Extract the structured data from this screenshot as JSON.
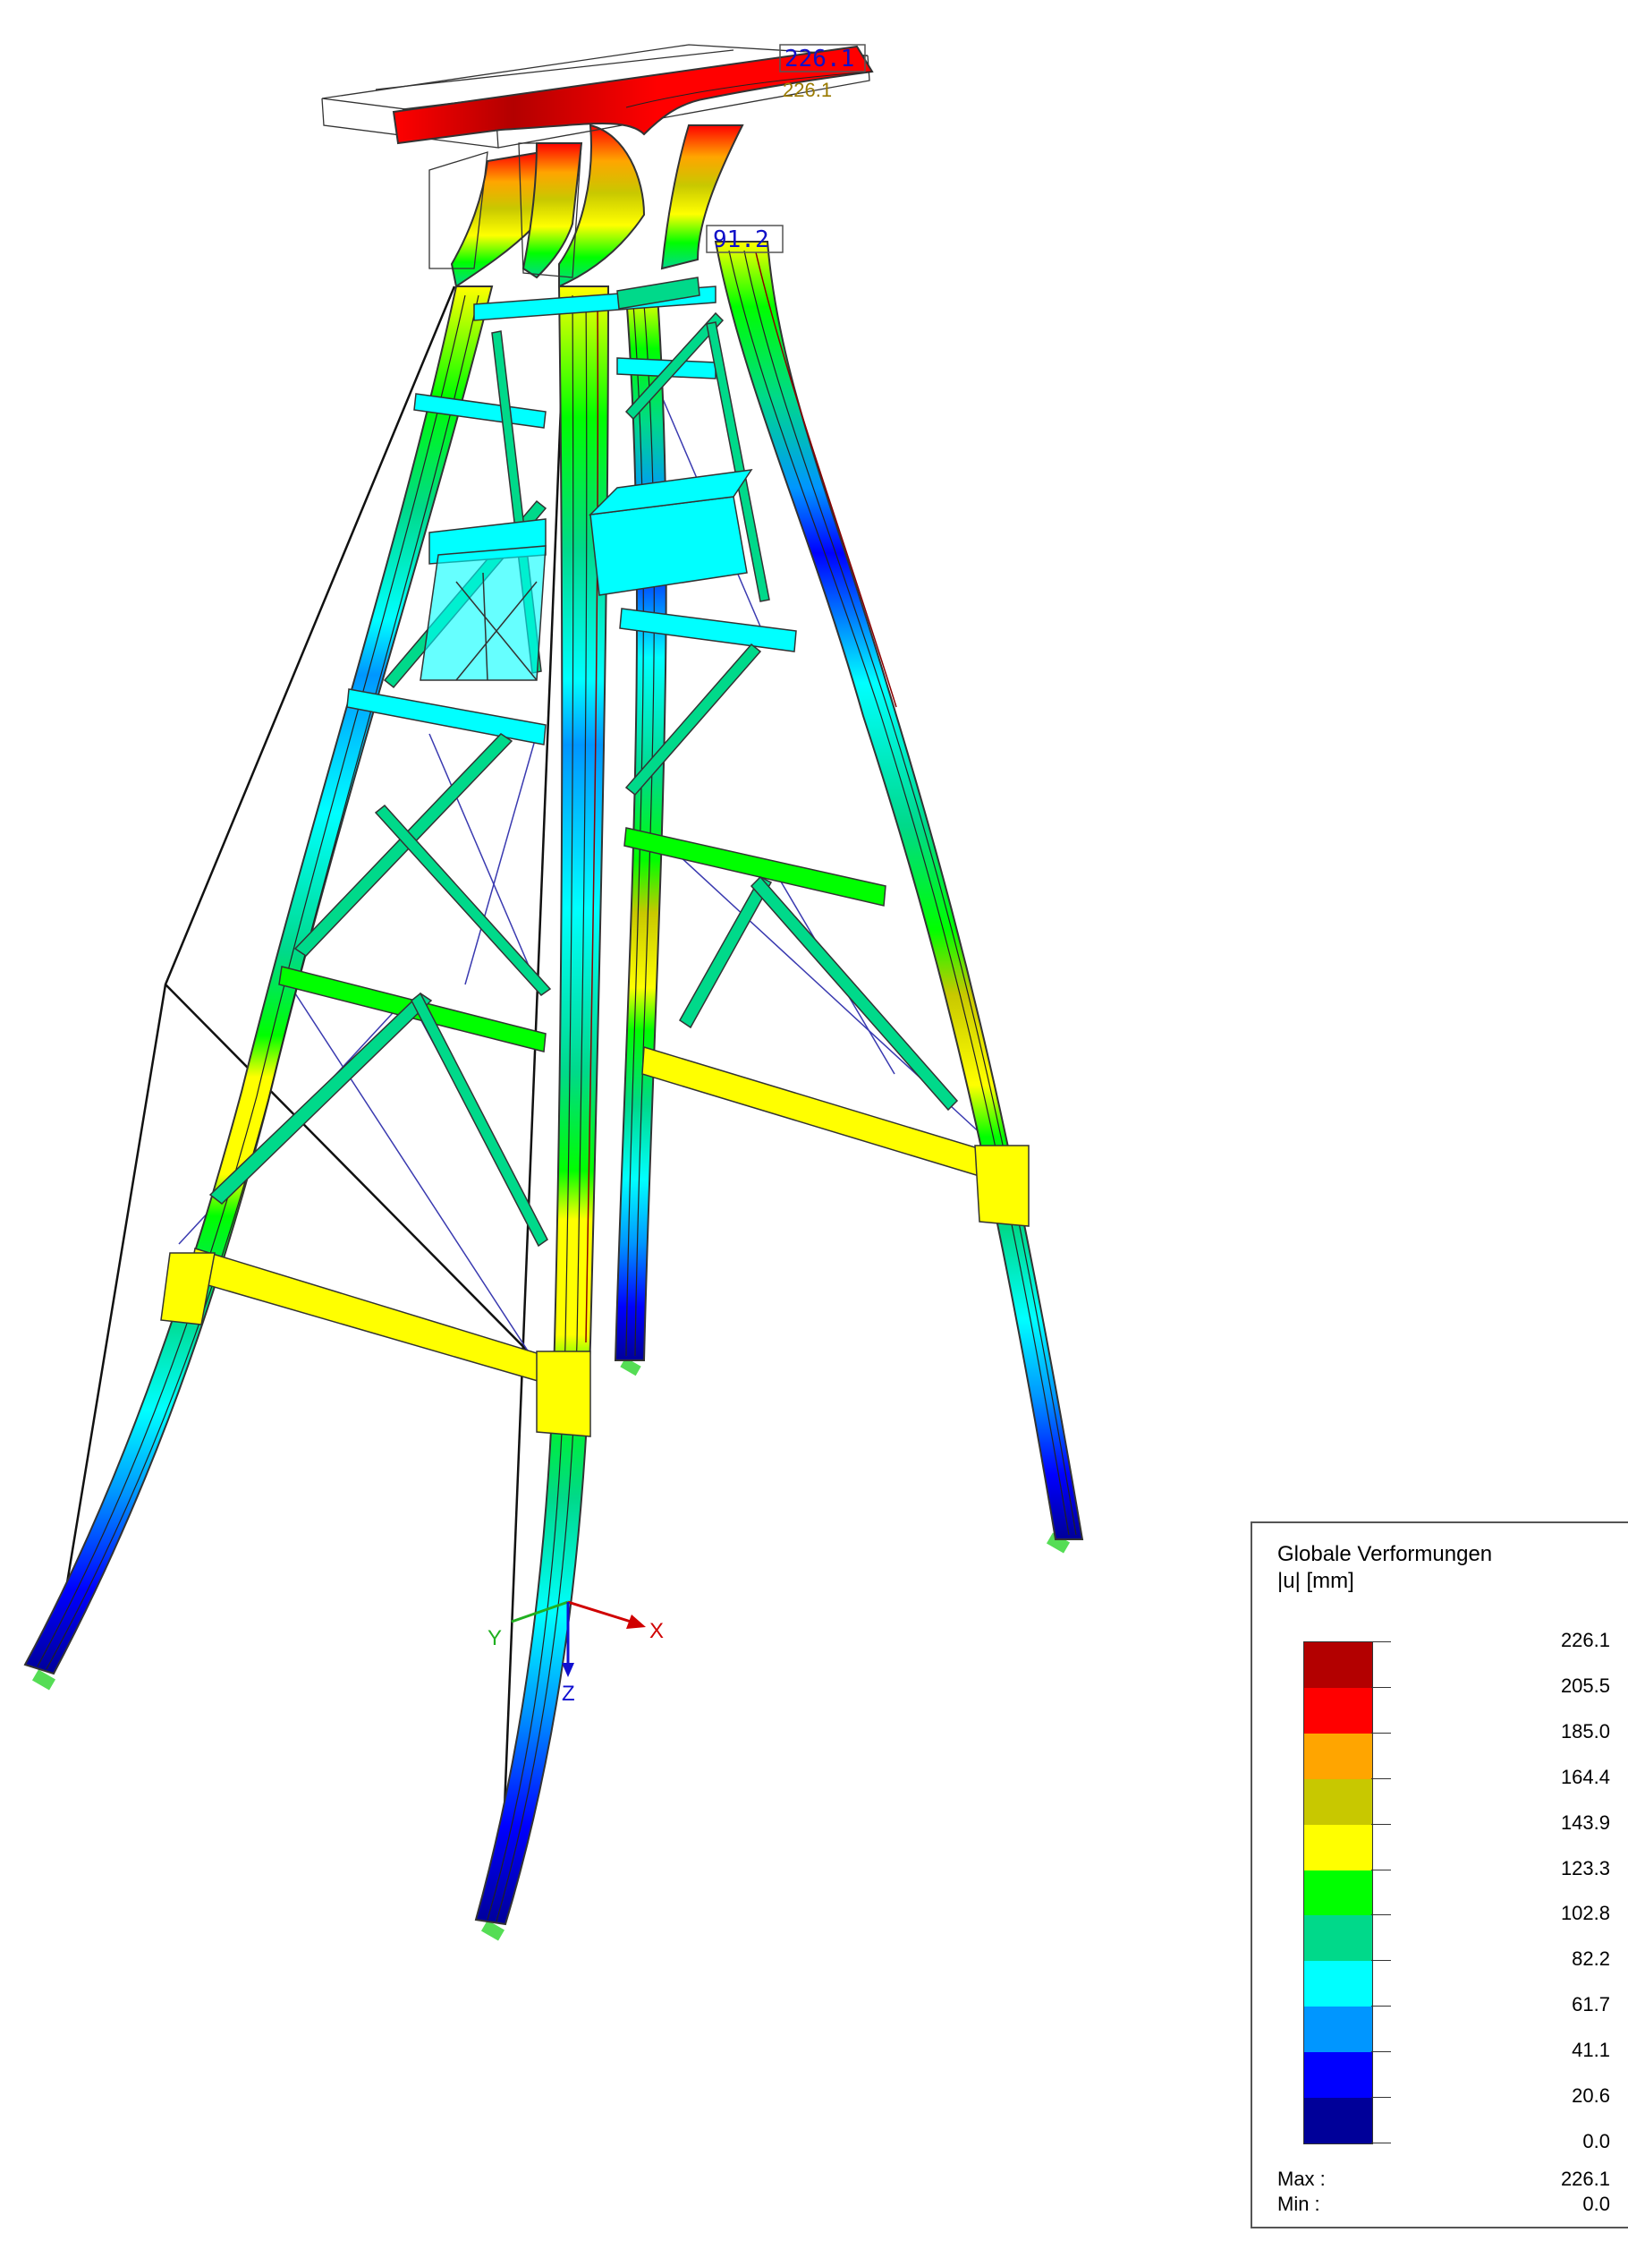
{
  "legend": {
    "title": "Globale Verformungen",
    "unit": "|u| [mm]",
    "values": [
      "226.1",
      "205.5",
      "185.0",
      "164.4",
      "143.9",
      "123.3",
      "102.8",
      "82.2",
      "61.7",
      "41.1",
      "20.6",
      "0.0"
    ],
    "colors": [
      "#b30000",
      "#ff0000",
      "#ffa500",
      "#c8c800",
      "#ffff00",
      "#00ff00",
      "#00d98a",
      "#00ffff",
      "#0096ff",
      "#0000ff",
      "#000099"
    ],
    "max_label": "Max :",
    "max_value": "226.1",
    "min_label": "Min :",
    "min_value": "0.0"
  },
  "annotations": {
    "top_max_box": "226.1",
    "top_max_text": "226.1",
    "mid_box": "91.2"
  },
  "axes": {
    "x": "X",
    "y": "Y",
    "z": "Z"
  }
}
